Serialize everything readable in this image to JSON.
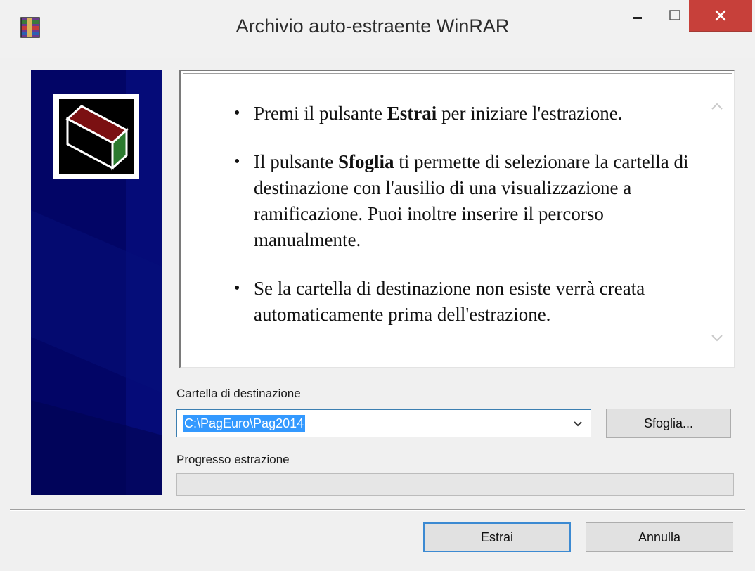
{
  "window": {
    "title": "Archivio auto-estraente WinRAR",
    "icon": "winrar-icon",
    "controls": {
      "minimize": "minimize-icon",
      "maximize": "maximize-icon",
      "close": "close-icon"
    }
  },
  "banner": {
    "logo": "winrar-box-logo",
    "background_color": "#020566"
  },
  "info": {
    "bullets": [
      {
        "pre": "Premi il pulsante ",
        "bold": "Estrai",
        "post": " per iniziare l'estrazione."
      },
      {
        "pre": "Il pulsante ",
        "bold": "Sfoglia",
        "post": " ti permette di selezionare la cartella di destinazione con l'ausilio di una visualizzazione a ramificazione. Puoi inoltre inserire il percorso manualmente."
      },
      {
        "pre": "Se la cartella di destinazione non esiste verrà creata automaticamente prima dell'estrazione.",
        "bold": "",
        "post": ""
      }
    ]
  },
  "destination": {
    "label": "Cartella di destinazione",
    "value": "C:\\PagEuro\\Pag2014",
    "browse_label": "Sfoglia..."
  },
  "progress": {
    "label": "Progresso estrazione",
    "value": 0
  },
  "footer": {
    "extract_label": "Estrai",
    "cancel_label": "Annulla"
  },
  "colors": {
    "close_button": "#c7403a",
    "selection": "#3399ff",
    "default_button_border": "#3c8ad2"
  }
}
